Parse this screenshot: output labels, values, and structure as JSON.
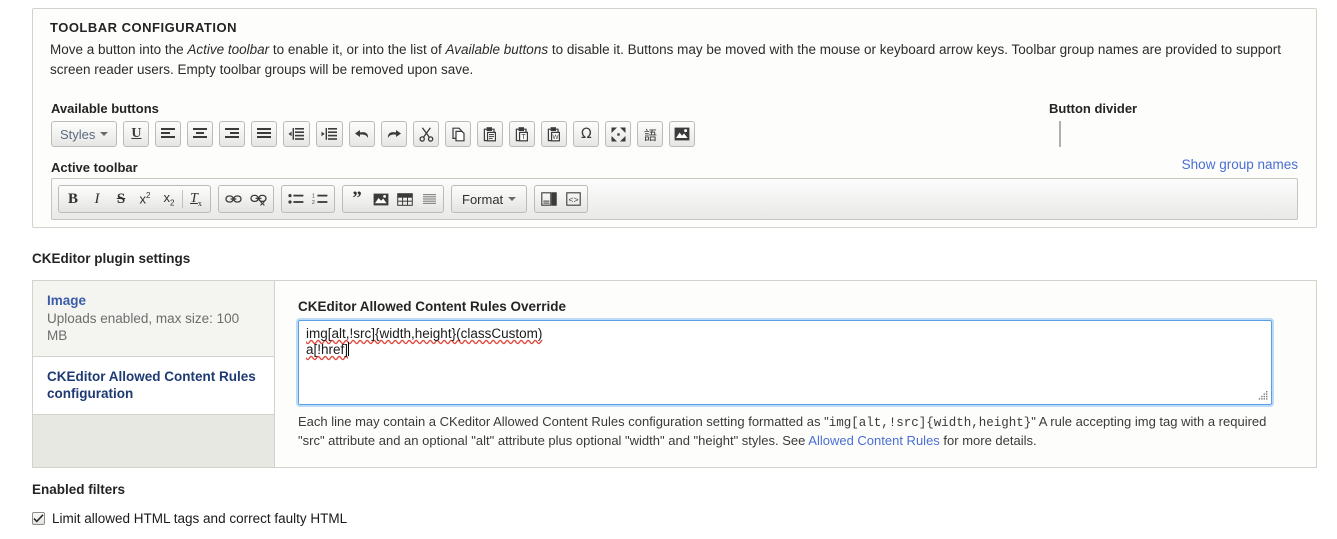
{
  "toolbar_config": {
    "legend": "TOOLBAR CONFIGURATION",
    "description_part1": "Move a button into the ",
    "description_em1": "Active toolbar",
    "description_part2": " to enable it, or into the list of ",
    "description_em2": "Available buttons",
    "description_part3": " to disable it. Buttons may be moved with the mouse or keyboard arrow keys. Toolbar group names are provided to support screen reader users. Empty toolbar groups will be removed upon save.",
    "available_label": "Available buttons",
    "active_label": "Active toolbar",
    "divider_label": "Button divider",
    "show_group_names": "Show group names",
    "available_buttons": [
      {
        "name": "styles-dropdown",
        "label": "Styles",
        "icon": "styles-dropdown",
        "type": "dropdown"
      },
      {
        "name": "underline",
        "label": "U",
        "icon": "underline-icon"
      },
      {
        "name": "align-left",
        "label": "",
        "icon": "align-left-icon"
      },
      {
        "name": "align-center",
        "label": "",
        "icon": "align-center-icon"
      },
      {
        "name": "align-right",
        "label": "",
        "icon": "align-right-icon"
      },
      {
        "name": "justify",
        "label": "",
        "icon": "justify-icon"
      },
      {
        "name": "outdent",
        "label": "",
        "icon": "outdent-icon"
      },
      {
        "name": "indent",
        "label": "",
        "icon": "indent-icon"
      },
      {
        "name": "undo",
        "label": "",
        "icon": "undo-icon"
      },
      {
        "name": "redo",
        "label": "",
        "icon": "redo-icon"
      },
      {
        "name": "cut",
        "label": "",
        "icon": "cut-icon"
      },
      {
        "name": "copy",
        "label": "",
        "icon": "copy-icon"
      },
      {
        "name": "paste",
        "label": "",
        "icon": "paste-icon"
      },
      {
        "name": "paste-text",
        "label": "",
        "icon": "paste-text-icon"
      },
      {
        "name": "paste-word",
        "label": "",
        "icon": "paste-from-word-icon"
      },
      {
        "name": "special-character",
        "label": "Ω",
        "icon": "omega-icon"
      },
      {
        "name": "maximize",
        "label": "",
        "icon": "maximize-icon"
      },
      {
        "name": "show-blocks",
        "label": "話",
        "icon": "show-blocks-icon"
      },
      {
        "name": "media-embed",
        "label": "",
        "icon": "media-embed-icon"
      }
    ],
    "active_groups": [
      {
        "group": "formatting",
        "buttons": [
          {
            "name": "bold",
            "label": "B",
            "icon": "bold-icon"
          },
          {
            "name": "italic",
            "label": "I",
            "icon": "italic-icon"
          },
          {
            "name": "strikethrough",
            "label": "S",
            "icon": "strikethrough-icon"
          },
          {
            "name": "superscript",
            "label": "x²",
            "icon": "superscript-icon"
          },
          {
            "name": "subscript",
            "label": "x₂",
            "icon": "subscript-icon"
          },
          {
            "name": "remove-format",
            "label": "Tx",
            "icon": "remove-format-icon",
            "separator_before": true
          }
        ]
      },
      {
        "group": "links",
        "buttons": [
          {
            "name": "link",
            "label": "",
            "icon": "link-icon"
          },
          {
            "name": "unlink",
            "label": "",
            "icon": "unlink-icon"
          }
        ]
      },
      {
        "group": "lists",
        "buttons": [
          {
            "name": "bulleted-list",
            "label": "",
            "icon": "bulleted-list-icon"
          },
          {
            "name": "numbered-list",
            "label": "",
            "icon": "numbered-list-icon"
          }
        ]
      },
      {
        "group": "media",
        "buttons": [
          {
            "name": "blockquote",
            "label": "”",
            "icon": "blockquote-icon"
          },
          {
            "name": "image",
            "label": "",
            "icon": "image-icon"
          },
          {
            "name": "table",
            "label": "",
            "icon": "table-icon"
          },
          {
            "name": "horizontal-rule",
            "label": "",
            "icon": "horizontal-rule-icon"
          }
        ]
      },
      {
        "group": "format-dropdown",
        "buttons": [
          {
            "name": "format-dropdown",
            "label": "Format",
            "icon": "format-dropdown",
            "type": "dropdown"
          }
        ]
      },
      {
        "group": "tools",
        "buttons": [
          {
            "name": "templates",
            "label": "",
            "icon": "templates-icon"
          },
          {
            "name": "source",
            "label": "",
            "icon": "source-code-icon"
          }
        ]
      }
    ]
  },
  "plugin_settings": {
    "title": "CKEditor plugin settings",
    "tabs": [
      {
        "name": "image",
        "label": "Image",
        "summary": "Uploads enabled, max size: 100 MB",
        "active": false
      },
      {
        "name": "allowed-content-rules",
        "label": "CKEditor Allowed Content Rules configuration",
        "summary": "",
        "active": true
      }
    ],
    "pane": {
      "label": "CKEditor Allowed Content Rules Override",
      "textarea_value_line1": "img[alt,!src]{width,height}(classCustom)",
      "textarea_value_line2": "a[!href]",
      "textarea_placeholder": "",
      "description_part1": "Each line may contain a CKeditor Allowed Content Rules configuration setting formatted as \"",
      "description_code": "img[alt,!src]{width,height}",
      "description_part2": "\" A rule accepting img tag with a required \"src\" attribute and an optional \"alt\" attribute plus optional \"width\" and \"height\" styles. See ",
      "description_link": "Allowed Content Rules",
      "description_part3": " for more details."
    }
  },
  "enabled_filters": {
    "title": "Enabled filters",
    "items": [
      {
        "name": "limit-allowed-html",
        "label": "Limit allowed HTML tags and correct faulty HTML",
        "checked": true
      }
    ]
  },
  "colors": {
    "link": "#4a6fd4",
    "tab_active": "#1e3a73",
    "format_accent": "#b4651a",
    "focus_border": "#5aa0e8",
    "spellcheck": "#e04a3f"
  }
}
